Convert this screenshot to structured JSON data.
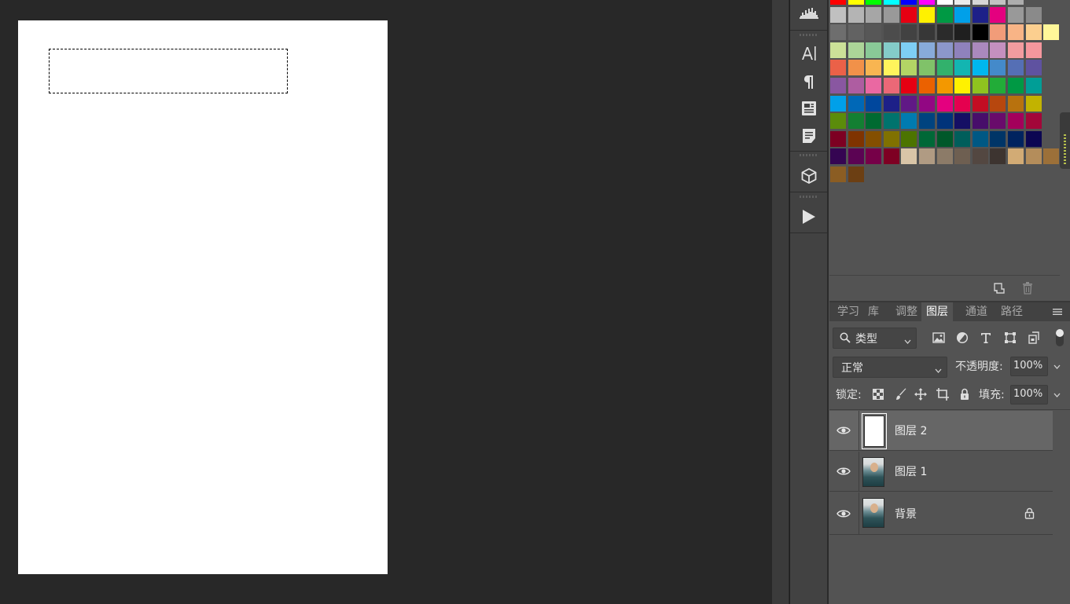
{
  "swatches": {
    "rows": [
      [
        "#ff0000",
        "#ffff00",
        "#00ff00",
        "#00ffff",
        "#0000ff",
        "#ff00ff",
        "#ffffff",
        "#ebebeb",
        "#d6d6d6",
        "#c2c2c2",
        "#adadad"
      ],
      [
        "#c0c0c0",
        "#b4b4b4",
        "#a6a6a6",
        "#999999",
        "#e60012",
        "#fff100",
        "#009944",
        "#00a0e9",
        "#1d2088",
        "#e4007f",
        "#999999",
        "#8a8a8a"
      ],
      [
        "#6e6e6e",
        "#626262",
        "#575757",
        "#4c4c4c",
        "#424242",
        "#373737",
        "#2b2b2b",
        "#1f1f1f",
        "#000000",
        "#f19c79",
        "#f8b486",
        "#fccf8f",
        "#fff799"
      ],
      [
        "#cce198",
        "#acd598",
        "#89c997",
        "#84ccc9",
        "#7ecef4",
        "#88abda",
        "#8c97cb",
        "#8f82bc",
        "#aa89bd",
        "#c490bf",
        "#f29c9f",
        "#f5979d"
      ],
      [
        "#eb6148",
        "#f19149",
        "#f8b551",
        "#fff45c",
        "#b3d465",
        "#80c269",
        "#32b16c",
        "#13b5b1",
        "#00b7ee",
        "#448aca",
        "#556fb5",
        "#5f52a0"
      ],
      [
        "#8957a1",
        "#ae5da1",
        "#ea68a2",
        "#eb6877",
        "#e60012",
        "#eb6100",
        "#f39800",
        "#fff100",
        "#8fc31f",
        "#22ac38",
        "#009944",
        "#009e96"
      ],
      [
        "#00a0e9",
        "#0068b7",
        "#00479d",
        "#1d2088",
        "#601986",
        "#920783",
        "#e4007f",
        "#e5004f",
        "#c30d23",
        "#b7470e",
        "#b8720e",
        "#c2b300"
      ],
      [
        "#5b8c0b",
        "#137f32",
        "#006a31",
        "#00736d",
        "#007bb0",
        "#00437f",
        "#01337a",
        "#150f64",
        "#470e6a",
        "#690b6b",
        "#a4005b",
        "#a30739"
      ],
      [
        "#7d0022",
        "#7f3300",
        "#844f00",
        "#807100",
        "#4c7400",
        "#006837",
        "#00582a",
        "#005e5b",
        "#005884",
        "#003567",
        "#00235f",
        "#0c0652"
      ],
      [
        "#350552",
        "#5b0353",
        "#760048",
        "#7e0023",
        "#d9c5a7",
        "#b09b83",
        "#8c7b68",
        "#6e5f51",
        "#534741",
        "#3d3430",
        "#d2ab75",
        "#b48d5b",
        "#9c7039"
      ],
      [
        "#8b5d23",
        "#6c3f13"
      ]
    ]
  },
  "icon_bar": {
    "icons": [
      "histogram-icon",
      "character-icon",
      "paragraph-icon",
      "paragraph-styles-icon",
      "character-styles-icon",
      "3d-icon",
      "actions-play-icon"
    ]
  },
  "tabs": [
    "学习",
    "库",
    "调整",
    "图层",
    "通道",
    "路径"
  ],
  "active_tab": "图层",
  "filter": {
    "label": "类型"
  },
  "blend": {
    "mode": "正常",
    "opacity_label": "不透明度:",
    "opacity_value": "100%"
  },
  "lock": {
    "label": "锁定:",
    "fill_label": "填充:",
    "fill_value": "100%"
  },
  "layers": [
    {
      "name": "图层 2",
      "thumb": "white",
      "selected": true,
      "locked": false
    },
    {
      "name": "图层 1",
      "thumb": "photo",
      "selected": false,
      "locked": false
    },
    {
      "name": "背景",
      "thumb": "photo",
      "selected": false,
      "locked": true
    }
  ],
  "colors": {
    "canvas_bg": "#282828",
    "panel_bg": "#535353",
    "selected_layer": "#666666",
    "document": "#ffffff"
  }
}
